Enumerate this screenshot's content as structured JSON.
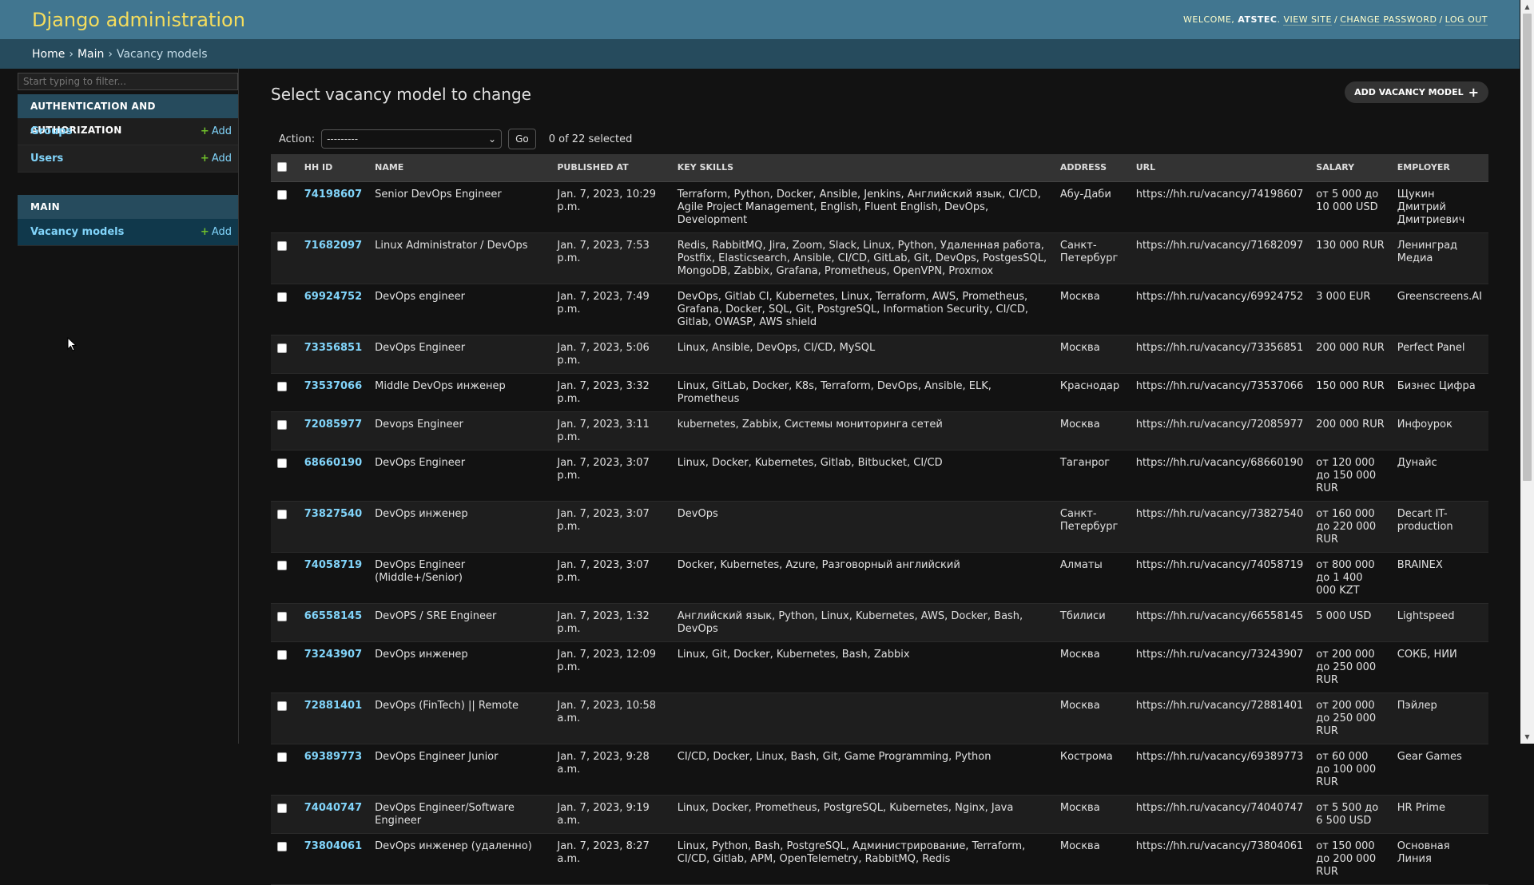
{
  "header": {
    "branding": "Django administration",
    "welcome": "Welcome,",
    "username": "ATSTEC",
    "view_site": "View site",
    "change_password": "Change password",
    "log_out": "Log out",
    "sep": "/"
  },
  "breadcrumbs": {
    "home": "Home",
    "main": "Main",
    "current": "Vacancy models",
    "sep": "›"
  },
  "sidebar": {
    "filter_placeholder": "Start typing to filter...",
    "toggle_icon": "«",
    "modules": [
      {
        "caption": "Authentication and Authorization",
        "models": [
          {
            "name": "Groups",
            "add": "Add"
          },
          {
            "name": "Users",
            "add": "Add"
          }
        ]
      },
      {
        "caption": "Main",
        "models": [
          {
            "name": "Vacancy models",
            "add": "Add"
          }
        ]
      }
    ]
  },
  "content": {
    "title": "Select vacancy model to change",
    "add_button": "Add vacancy model",
    "action_label": "Action:",
    "action_selected": "---------",
    "go": "Go",
    "selected_count": "0 of 22 selected"
  },
  "table": {
    "columns": [
      "HH ID",
      "Name",
      "Published at",
      "Key skills",
      "Address",
      "URL",
      "Salary",
      "Employer"
    ],
    "rows": [
      {
        "id": "74198607",
        "name": "Senior DevOps Engineer",
        "published": "Jan. 7, 2023, 10:29 p.m.",
        "skills": "Terraform, Python, Docker, Ansible, Jenkins, Английский язык, CI/CD, Agile Project Management, English, Fluent English, DevOps, Development",
        "address": "Абу-Даби",
        "url": "https://hh.ru/vacancy/74198607",
        "salary": "от 5 000 до 10 000 USD",
        "employer": "Щукин Дмитрий Дмитриевич"
      },
      {
        "id": "71682097",
        "name": "Linux Administrator / DevOps",
        "published": "Jan. 7, 2023, 7:53 p.m.",
        "skills": "Redis, RabbitMQ, Jira, Zoom, Slack, Linux, Python, Удаленная работа, Postfix, Elasticsearch, Ansible, CI/CD, GitLab, Git, DevOps, PostgesSQL, MongoDB, Zabbix, Grafana, Prometheus, OpenVPN, Proxmox",
        "address": "Санкт-Петербург",
        "url": "https://hh.ru/vacancy/71682097",
        "salary": "130 000 RUR",
        "employer": "Ленинград Медиа"
      },
      {
        "id": "69924752",
        "name": "DevOps engineer",
        "published": "Jan. 7, 2023, 7:49 p.m.",
        "skills": "DevOps, Gitlab CI, Kubernetes, Linux, Terraform, AWS, Prometheus, Grafana, Docker, SQL, Git, PostgreSQL, Information Security, CI/CD, Gitlab, OWASP, AWS shield",
        "address": "Москва",
        "url": "https://hh.ru/vacancy/69924752",
        "salary": "3 000 EUR",
        "employer": "Greenscreens.AI"
      },
      {
        "id": "73356851",
        "name": "DevOps Engineer",
        "published": "Jan. 7, 2023, 5:06 p.m.",
        "skills": "Linux, Ansible, DevOps, CI/CD, MySQL",
        "address": "Москва",
        "url": "https://hh.ru/vacancy/73356851",
        "salary": "200 000 RUR",
        "employer": "Perfect Panel"
      },
      {
        "id": "73537066",
        "name": "Middle DevOps инженер",
        "published": "Jan. 7, 2023, 3:32 p.m.",
        "skills": "Linux, GitLab, Docker, K8s, Terraform, DevOps, Ansible, ELK, Prometheus",
        "address": "Краснодар",
        "url": "https://hh.ru/vacancy/73537066",
        "salary": "150 000 RUR",
        "employer": "Бизнес Цифра"
      },
      {
        "id": "72085977",
        "name": "Devops Engineer",
        "published": "Jan. 7, 2023, 3:11 p.m.",
        "skills": "kubernetes, Zabbix, Системы мониторинга сетей",
        "address": "Москва",
        "url": "https://hh.ru/vacancy/72085977",
        "salary": "200 000 RUR",
        "employer": "Инфоурок"
      },
      {
        "id": "68660190",
        "name": "DevOps Engineer",
        "published": "Jan. 7, 2023, 3:07 p.m.",
        "skills": "Linux, Docker, Kubernetes, Gitlab, Bitbucket, CI/CD",
        "address": "Таганрог",
        "url": "https://hh.ru/vacancy/68660190",
        "salary": "от 120 000 до 150 000 RUR",
        "employer": "Дунайс"
      },
      {
        "id": "73827540",
        "name": "DevOps инженер",
        "published": "Jan. 7, 2023, 3:07 p.m.",
        "skills": "DevOps",
        "address": "Санкт-Петербург",
        "url": "https://hh.ru/vacancy/73827540",
        "salary": "от 160 000 до 220 000 RUR",
        "employer": "Decart IT-production"
      },
      {
        "id": "74058719",
        "name": "DevOps Engineer (Middle+/Senior)",
        "published": "Jan. 7, 2023, 3:07 p.m.",
        "skills": "Docker, Kubernetes, Azure, Разговорный английский",
        "address": "Алматы",
        "url": "https://hh.ru/vacancy/74058719",
        "salary": "от 800 000 до 1 400 000 KZT",
        "employer": "BRAINEX"
      },
      {
        "id": "66558145",
        "name": "DevOPS / SRE Engineer",
        "published": "Jan. 7, 2023, 1:32 p.m.",
        "skills": "Английский язык, Python, Linux, Kubernetes, AWS, Docker, Bash, DevOps",
        "address": "Тбилиси",
        "url": "https://hh.ru/vacancy/66558145",
        "salary": "5 000 USD",
        "employer": "Lightspeed"
      },
      {
        "id": "73243907",
        "name": "DevOps инженер",
        "published": "Jan. 7, 2023, 12:09 p.m.",
        "skills": "Linux, Git, Docker, Kubernetes, Bash, Zabbix",
        "address": "Москва",
        "url": "https://hh.ru/vacancy/73243907",
        "salary": "от 200 000 до 250 000 RUR",
        "employer": "СОКБ, НИИ"
      },
      {
        "id": "72881401",
        "name": "DevOps (FinTech) || Remote",
        "published": "Jan. 7, 2023, 10:58 a.m.",
        "skills": "",
        "address": "Москва",
        "url": "https://hh.ru/vacancy/72881401",
        "salary": "от 200 000 до 250 000 RUR",
        "employer": "Пэйлер"
      },
      {
        "id": "69389773",
        "name": "DevOps Engineer Junior",
        "published": "Jan. 7, 2023, 9:28 a.m.",
        "skills": "CI/CD, Docker, Linux, Bash, Git, Game Programming, Python",
        "address": "Кострома",
        "url": "https://hh.ru/vacancy/69389773",
        "salary": "от 60 000 до 100 000 RUR",
        "employer": "Gear Games"
      },
      {
        "id": "74040747",
        "name": "DevOps Engineer/Software Engineer",
        "published": "Jan. 7, 2023, 9:19 a.m.",
        "skills": "Linux, Docker, Prometheus, PostgreSQL, Kubernetes, Nginx, Java",
        "address": "Москва",
        "url": "https://hh.ru/vacancy/74040747",
        "salary": "от 5 500 до 6 500 USD",
        "employer": "HR Prime"
      },
      {
        "id": "73804061",
        "name": "DevOps инженер (удаленно)",
        "published": "Jan. 7, 2023, 8:27 a.m.",
        "skills": "Linux, Python, Bash, PostgreSQL, Администрирование, Terraform, CI/CD, Gitlab, APM, OpenTelemetry, RabbitMQ, Redis",
        "address": "Москва",
        "url": "https://hh.ru/vacancy/73804061",
        "salary": "от 150 000 до 200 000 RUR",
        "employer": "Основная Линия"
      }
    ]
  }
}
